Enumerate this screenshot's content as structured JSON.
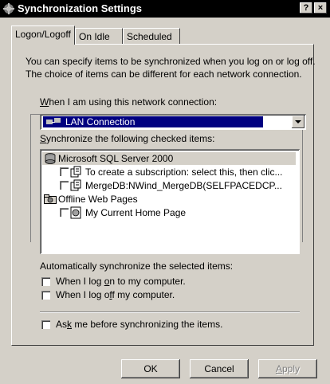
{
  "window": {
    "title": "Synchronization Settings",
    "help_label": "?",
    "close_label": "×"
  },
  "tabs": [
    {
      "label": "Logon/Logoff",
      "active": true
    },
    {
      "label": "On Idle",
      "active": false
    },
    {
      "label": "Scheduled",
      "active": false
    }
  ],
  "description": {
    "line1": "You can specify items to be synchronized when you log on or log off.",
    "line2": "The choice of items can be different for each network connection."
  },
  "connection": {
    "label_pre": "",
    "label_hotkey": "W",
    "label_post": "hen I am using this network connection:",
    "selected": "LAN Connection"
  },
  "items": {
    "label_hotkey": "S",
    "label_post": "ynchronize the following checked items:",
    "list": [
      {
        "text": "Microsoft SQL Server 2000",
        "icon": "database-icon",
        "level": 0,
        "checkbox": false
      },
      {
        "text": "To create a subscription: select this, then clic...",
        "icon": "subscription-icon",
        "level": 1,
        "checkbox": true
      },
      {
        "text": "MergeDB:NWind_MergeDB(SELFPACEDCP...",
        "icon": "subscription-icon",
        "level": 1,
        "checkbox": true
      },
      {
        "text": "Offline Web Pages",
        "icon": "web-pages-folder-icon",
        "level": 0,
        "checkbox": false
      },
      {
        "text": "My Current Home Page",
        "icon": "web-page-icon",
        "level": 1,
        "checkbox": true
      }
    ]
  },
  "auto": {
    "label": "Automatically synchronize the selected items:",
    "logon_pre": "When I log ",
    "logon_hotkey": "o",
    "logon_post": "n to my computer.",
    "logoff_pre": "When I log o",
    "logoff_hotkey": "f",
    "logoff_post": "f my computer."
  },
  "ask": {
    "pre": "As",
    "hotkey": "k",
    "post": " me before synchronizing the items."
  },
  "buttons": {
    "ok": "OK",
    "cancel": "Cancel",
    "apply_hotkey": "A",
    "apply_post": "pply"
  }
}
